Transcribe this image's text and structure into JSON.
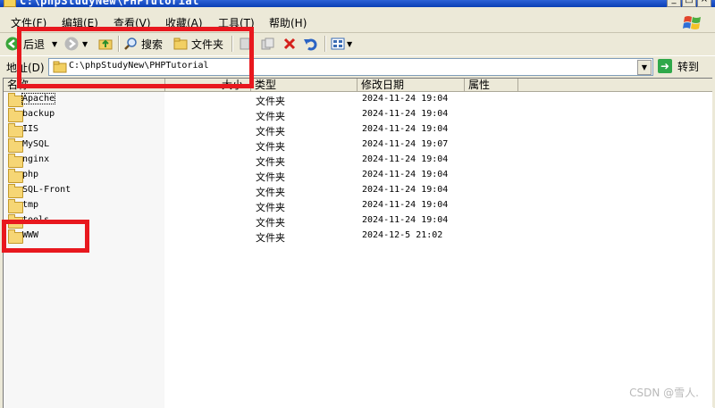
{
  "window": {
    "title": "C:\\phpStudyNew\\PHPTutorial"
  },
  "menu": [
    {
      "label": "文件(F)"
    },
    {
      "label": "编辑(E)"
    },
    {
      "label": "查看(V)"
    },
    {
      "label": "收藏(A)"
    },
    {
      "label": "工具(T)"
    },
    {
      "label": "帮助(H)"
    }
  ],
  "toolbar": {
    "back_label": "后退",
    "search_label": "搜索",
    "folders_label": "文件夹"
  },
  "address": {
    "label": "地址(D)",
    "value": "C:\\phpStudyNew\\PHPTutorial",
    "go_label": "转到"
  },
  "columns": {
    "name": "名称",
    "size": "大小",
    "type": "类型",
    "modified": "修改日期",
    "attributes": "属性"
  },
  "files": [
    {
      "name": "Apache",
      "type": "文件夹",
      "modified": "2024-11-24 19:04"
    },
    {
      "name": "backup",
      "type": "文件夹",
      "modified": "2024-11-24 19:04"
    },
    {
      "name": "IIS",
      "type": "文件夹",
      "modified": "2024-11-24 19:04"
    },
    {
      "name": "MySQL",
      "type": "文件夹",
      "modified": "2024-11-24 19:07"
    },
    {
      "name": "nginx",
      "type": "文件夹",
      "modified": "2024-11-24 19:04"
    },
    {
      "name": "php",
      "type": "文件夹",
      "modified": "2024-11-24 19:04"
    },
    {
      "name": "SQL-Front",
      "type": "文件夹",
      "modified": "2024-11-24 19:04"
    },
    {
      "name": "tmp",
      "type": "文件夹",
      "modified": "2024-11-24 19:04"
    },
    {
      "name": "tools",
      "type": "文件夹",
      "modified": "2024-11-24 19:04"
    },
    {
      "name": "WWW",
      "type": "文件夹",
      "modified": "2024-12-5 21:02"
    }
  ],
  "watermark": "CSDN @雪人.",
  "colors": {
    "annotation": "#e8181e",
    "titlebar": "#0a3fb5"
  }
}
